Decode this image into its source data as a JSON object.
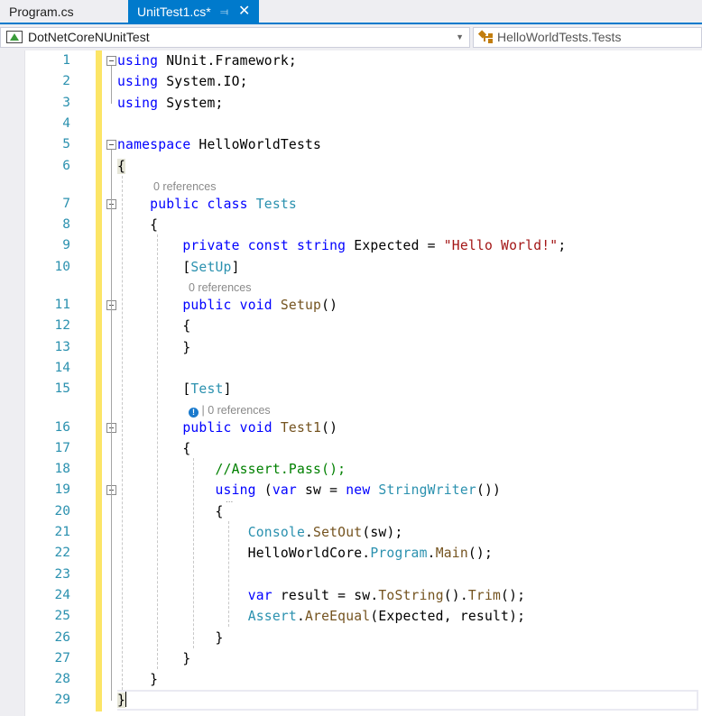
{
  "tabs": [
    {
      "label": "Program.cs",
      "active": false
    },
    {
      "label": "UnitTest1.cs*",
      "active": true,
      "pin_icon": "pin-icon",
      "close_icon": "close-icon"
    }
  ],
  "navbar": {
    "project": "DotNetCoreNUnitTest",
    "project_icon": "test-project-icon",
    "type": "HelloWorldTests.Tests",
    "type_icon": "class-icon"
  },
  "editor": {
    "accent": "#007acc",
    "lines": [
      {
        "n": "1",
        "html": "<span class='kw'>using</span> NUnit.Framework;"
      },
      {
        "n": "2",
        "html": "<span class='kw'>using</span> System.IO;"
      },
      {
        "n": "3",
        "html": "<span class='kw'>using</span> System;"
      },
      {
        "n": "4",
        "html": ""
      },
      {
        "n": "5",
        "html": "<span class='kw'>namespace</span> HelloWorldTests"
      },
      {
        "n": "6",
        "html": "<span class='brace-hl'>{</span>"
      },
      {
        "n": "7",
        "html": "    <span class='kw'>public</span> <span class='kw'>class</span> <span class='ty'>Tests</span>"
      },
      {
        "n": "8",
        "html": "    {"
      },
      {
        "n": "9",
        "html": "        <span class='kw'>private</span> <span class='kw'>const</span> <span class='kw'>string</span> Expected = <span class='str'>\"Hello World!\"</span>;"
      },
      {
        "n": "10",
        "html": "        [<span class='ty'>SetUp</span>]"
      },
      {
        "n": "11",
        "html": "        <span class='kw'>public</span> <span class='kw'>void</span> <span class='mt'>Setup</span>()"
      },
      {
        "n": "12",
        "html": "        {"
      },
      {
        "n": "13",
        "html": "        }"
      },
      {
        "n": "14",
        "html": ""
      },
      {
        "n": "15",
        "html": "        [<span class='ty'>Test</span>]"
      },
      {
        "n": "16",
        "html": "        <span class='kw'>public</span> <span class='kw'>void</span> <span class='mt'>Test1</span>()"
      },
      {
        "n": "17",
        "html": "        {"
      },
      {
        "n": "18",
        "html": "            <span class='cm'>//Assert.Pass();</span>"
      },
      {
        "n": "19",
        "html": "            <span class='kw'>using</span> (<span class='kw'>var</span> sw = <span class='kw'>new</span> <span class='ty'>StringWriter</span>())"
      },
      {
        "n": "20",
        "html": "            {"
      },
      {
        "n": "21",
        "html": "                <span class='ty'>Console</span>.<span class='mt'>SetOut</span>(sw);"
      },
      {
        "n": "22",
        "html": "                HelloWorldCore.<span class='ty'>Program</span>.<span class='mt'>Main</span>();"
      },
      {
        "n": "23",
        "html": ""
      },
      {
        "n": "24",
        "html": "                <span class='kw'>var</span> result = sw.<span class='mt'>ToString</span>().<span class='mt'>Trim</span>();"
      },
      {
        "n": "25",
        "html": "                <span class='ty'>Assert</span>.<span class='mt'>AreEqual</span>(Expected, result);"
      },
      {
        "n": "26",
        "html": "            }"
      },
      {
        "n": "27",
        "html": "        }"
      },
      {
        "n": "28",
        "html": "    }"
      },
      {
        "n": "29",
        "html": "<span class='brace-hl'>}</span><span class='caret'></span>"
      }
    ],
    "codelens": {
      "class_tests": "0 references",
      "method_setup": "0 references",
      "method_test1": "0 references",
      "test1_info_icon": "test-status-icon"
    }
  }
}
